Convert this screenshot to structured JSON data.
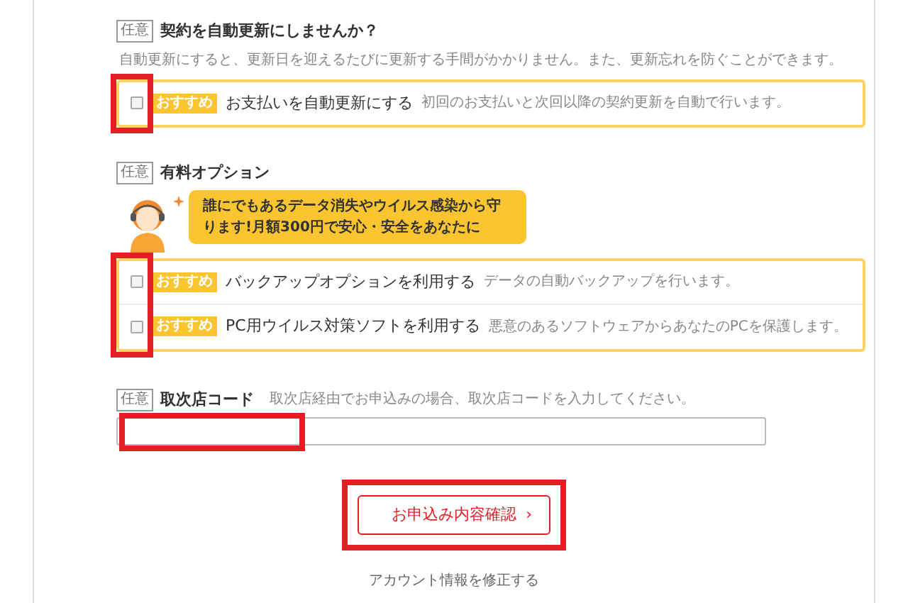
{
  "sections": [
    {
      "kind": "options",
      "tag": "任意",
      "title": "契約を自動更新にしませんか？",
      "description": "自動更新にすると、更新日を迎えるたびに更新する手間がかかりません。また、更新忘れを防ぐことができます。",
      "highlighted": true,
      "options": [
        {
          "badge": "おすすめ",
          "label": "お支払いを自動更新にする",
          "note": "初回のお支払いと次回以降の契約更新を自動で行います。",
          "checked": false
        }
      ]
    },
    {
      "kind": "options",
      "tag": "任意",
      "title": "有料オプション",
      "callout": "誰にでもあるデータ消失やウイルス感染から守ります!月額300円で安心・安全をあなたに",
      "highlighted": true,
      "options": [
        {
          "badge": "おすすめ",
          "label": "バックアップオプションを利用する",
          "note": "データの自動バックアップを行います。",
          "checked": false
        },
        {
          "badge": "おすすめ",
          "label": "PC用ウイルス対策ソフトを利用する",
          "note": "悪意のあるソフトウェアからあなたのPCを保護します。",
          "checked": false
        }
      ]
    },
    {
      "kind": "input",
      "tag": "任意",
      "title": "取次店コード",
      "hint": "取次店経由でお申込みの場合、取次店コードを入力してください。",
      "highlighted": true
    }
  ],
  "submit": {
    "label": "お申込み内容確認",
    "arrow": "›",
    "highlighted": true
  },
  "link": "アカウント情報を修正する"
}
